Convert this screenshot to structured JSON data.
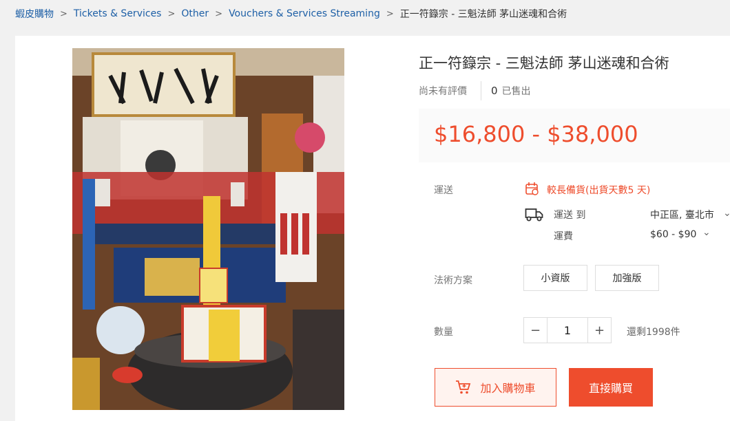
{
  "breadcrumb": {
    "items": [
      "蝦皮購物",
      "Tickets & Services",
      "Other",
      "Vouchers & Services Streaming"
    ],
    "current": "正一符籙宗 - 三魁法師 茅山迷魂和合術",
    "separator": ">"
  },
  "product": {
    "title": "正一符籙宗 - 三魁法師 茅山迷魂和合術",
    "rating_text": "尚未有評價",
    "sold_count": "0",
    "sold_label": "已售出",
    "price": "$16,800 - $38,000"
  },
  "shipping": {
    "label": "運送",
    "preorder_text": "較長備貨(出貨天數5 天)",
    "ship_to_label": "運送 到",
    "ship_to_value": "中正區, 臺北市",
    "fee_label": "運費",
    "fee_value": "$60 - $90"
  },
  "variants": {
    "label": "法術方案",
    "options": [
      "小資版",
      "加強版"
    ]
  },
  "quantity": {
    "label": "數量",
    "value": "1",
    "minus": "−",
    "plus": "+",
    "stock_text": "還剩1998件"
  },
  "actions": {
    "add_to_cart": "加入購物車",
    "buy_now": "直接購買"
  },
  "colors": {
    "accent": "#ee4d2d",
    "link": "#1d5fa6"
  }
}
